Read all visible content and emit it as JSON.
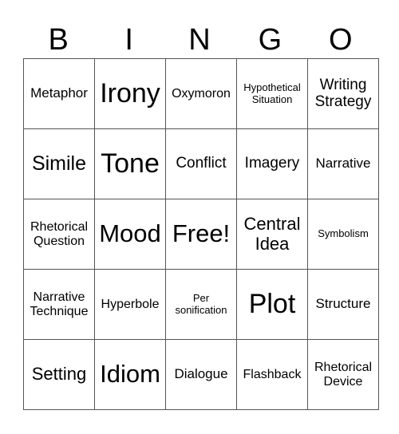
{
  "header": [
    "B",
    "I",
    "N",
    "G",
    "O"
  ],
  "grid": [
    [
      "Metaphor",
      "Irony",
      "Oxymoron",
      "Hypothetical\nSituation",
      "Writing\nStrategy"
    ],
    [
      "Simile",
      "Tone",
      "Conflict",
      "Imagery",
      "Narrative"
    ],
    [
      "Rhetorical\nQuestion",
      "Mood",
      "Free!",
      "Central\nIdea",
      "Symbolism"
    ],
    [
      "Narrative\nTechnique",
      "Hyperbole",
      "Per\nsonification",
      "Plot",
      "Structure"
    ],
    [
      "Setting",
      "Idiom",
      "Dialogue",
      "Flashback",
      "Rhetorical\nDevice"
    ]
  ]
}
